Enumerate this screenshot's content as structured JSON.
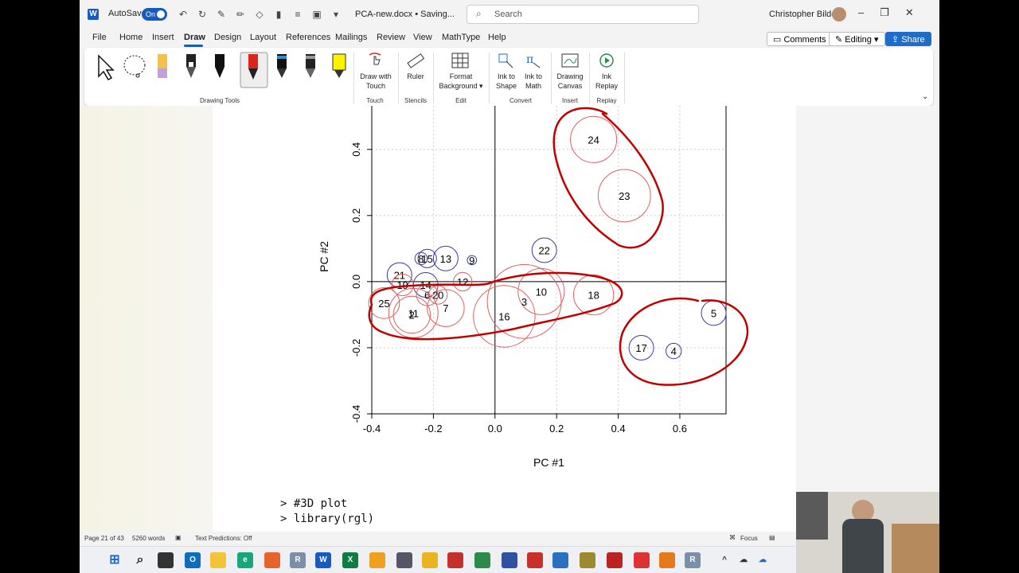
{
  "titlebar": {
    "autosave": "AutoSave",
    "toggle": "On",
    "doc_title": "PCA-new.docx • Saving...",
    "search_placeholder": "Search",
    "user": "Christopher Bilder"
  },
  "menu": {
    "tabs": [
      "File",
      "Home",
      "Insert",
      "Draw",
      "Design",
      "Layout",
      "References",
      "Mailings",
      "Review",
      "View",
      "MathType",
      "Help"
    ],
    "comments": "Comments",
    "editing": "Editing",
    "share": "Share"
  },
  "ribbon": {
    "groups": [
      "Drawing Tools",
      "Touch",
      "Stencils",
      "Edit",
      "Convert",
      "Insert",
      "Replay"
    ],
    "draw_with_touch": [
      "Draw with",
      "Touch"
    ],
    "ruler": "Ruler",
    "format_bg": [
      "Format",
      "Background"
    ],
    "ink_to_shape": [
      "Ink to",
      "Shape"
    ],
    "ink_to_math": [
      "Ink to",
      "Math"
    ],
    "drawing_canvas": [
      "Drawing",
      "Canvas"
    ],
    "ink_replay": [
      "Ink",
      "Replay"
    ]
  },
  "document": {
    "code_lines": [
      "> #3D plot",
      "> library(rgl)"
    ]
  },
  "chart_data": {
    "type": "scatter",
    "xlabel": "PC #1",
    "ylabel": "PC #2",
    "xlim": [
      -0.4,
      0.75
    ],
    "ylim": [
      -0.4,
      0.58
    ],
    "xticks": [
      "-0.4",
      "-0.2",
      "0.0",
      "0.2",
      "0.4",
      "0.6"
    ],
    "yticks": [
      "-0.4",
      "-0.2",
      "0.0",
      "0.2",
      "0.4",
      "0"
    ],
    "points": [
      {
        "label": "24",
        "x": 0.32,
        "y": 0.43,
        "r": 0.075,
        "c": "red"
      },
      {
        "label": "23",
        "x": 0.42,
        "y": 0.26,
        "r": 0.085,
        "c": "red"
      },
      {
        "label": "22",
        "x": 0.16,
        "y": 0.095,
        "r": 0.04,
        "c": "blue"
      },
      {
        "label": "13",
        "x": -0.16,
        "y": 0.07,
        "r": 0.04,
        "c": "blue"
      },
      {
        "label": "15",
        "x": -0.22,
        "y": 0.07,
        "r": 0.03,
        "c": "blue"
      },
      {
        "label": "8",
        "x": -0.24,
        "y": 0.07,
        "r": 0.02,
        "c": "blue"
      },
      {
        "label": "9",
        "x": -0.075,
        "y": 0.065,
        "r": 0.015,
        "c": "blue"
      },
      {
        "label": "21",
        "x": -0.31,
        "y": 0.02,
        "r": 0.04,
        "c": "blue"
      },
      {
        "label": "19",
        "x": -0.3,
        "y": -0.01,
        "r": 0.035,
        "c": "red"
      },
      {
        "label": "14",
        "x": -0.225,
        "y": -0.01,
        "r": 0.04,
        "c": "blue"
      },
      {
        "label": "12",
        "x": -0.105,
        "y": 0.0,
        "r": 0.03,
        "c": "red"
      },
      {
        "label": "6",
        "x": -0.22,
        "y": -0.04,
        "r": 0.035,
        "c": "red"
      },
      {
        "label": "20",
        "x": -0.185,
        "y": -0.04,
        "r": 0.03,
        "c": "red"
      },
      {
        "label": "25",
        "x": -0.36,
        "y": -0.065,
        "r": 0.05,
        "c": "red"
      },
      {
        "label": "11",
        "x": -0.265,
        "y": -0.095,
        "r": 0.08,
        "c": "red"
      },
      {
        "label": "2",
        "x": -0.27,
        "y": -0.1,
        "r": 0.06,
        "c": "red"
      },
      {
        "label": "7",
        "x": -0.16,
        "y": -0.08,
        "r": 0.06,
        "c": "red"
      },
      {
        "label": "10",
        "x": 0.15,
        "y": -0.03,
        "r": 0.075,
        "c": "red"
      },
      {
        "label": "3",
        "x": 0.095,
        "y": -0.06,
        "r": 0.12,
        "c": "red"
      },
      {
        "label": "16",
        "x": 0.03,
        "y": -0.105,
        "r": 0.1,
        "c": "red"
      },
      {
        "label": "18",
        "x": 0.32,
        "y": -0.04,
        "r": 0.065,
        "c": "red"
      },
      {
        "label": "5",
        "x": 0.71,
        "y": -0.095,
        "r": 0.04,
        "c": "blue"
      },
      {
        "label": "17",
        "x": 0.475,
        "y": -0.2,
        "r": 0.04,
        "c": "blue"
      },
      {
        "label": "4",
        "x": 0.58,
        "y": -0.21,
        "r": 0.025,
        "c": "blue"
      }
    ]
  },
  "status": {
    "page": "Page 21 of 43",
    "words": "5260 words",
    "predictions": "Text Predictions: Off",
    "focus": "Focus"
  }
}
